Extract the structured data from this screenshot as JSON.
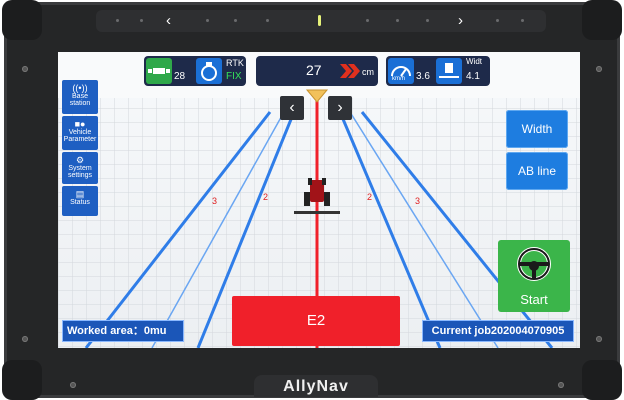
{
  "status_bar": {
    "satellites": "28",
    "rtk_label": "RTK",
    "rtk_status": "FIX",
    "deviation_value": "27",
    "deviation_unit": "cm",
    "speed_unit": "km/h",
    "speed_value": "3.6",
    "width_label": "Widt",
    "width_value": "4.1"
  },
  "sidebar": {
    "items": [
      {
        "label": "Base station",
        "icon": "antenna-icon"
      },
      {
        "label": "Vehicle Parameter",
        "icon": "tractor-icon"
      },
      {
        "label": "System settings",
        "icon": "gear-icon"
      },
      {
        "label": "Status",
        "icon": "status-icon"
      }
    ]
  },
  "right_panel": {
    "width_button": "Width",
    "ab_line_button": "AB line",
    "start_button": "Start"
  },
  "field": {
    "line_labels_left": [
      "3",
      "2"
    ],
    "line_labels_right": [
      "2",
      "3"
    ],
    "current_line": "E2"
  },
  "footer": {
    "worked_area": "Worked area：0mu",
    "current_job": "Current job202004070905"
  },
  "device": {
    "brand": "AllyNav"
  },
  "colors": {
    "accent_blue": "#1e7de0",
    "guide_red": "#f0202a",
    "start_green": "#3bb54a",
    "rtk_fix_green": "#35e05a"
  }
}
